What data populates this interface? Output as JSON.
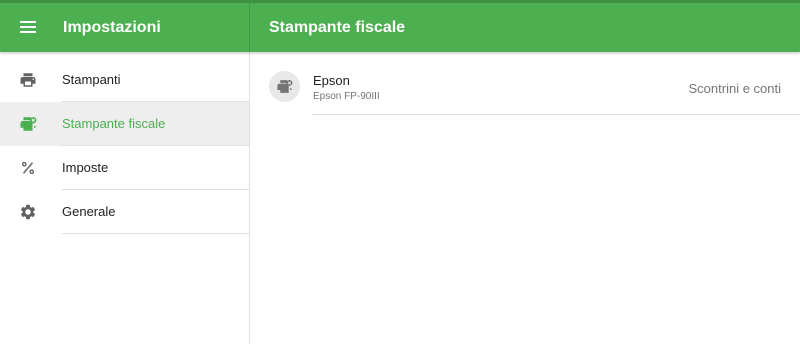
{
  "app": {
    "title": "Impostazioni",
    "menu_icon": "menu-icon",
    "accent_color": "#4caf50"
  },
  "sidebar": {
    "items": [
      {
        "label": "Stampanti",
        "icon": "printer-icon",
        "active": false
      },
      {
        "label": "Stampante fiscale",
        "icon": "fiscal-printer-icon",
        "active": true
      },
      {
        "label": "Imposte",
        "icon": "percent-icon",
        "active": false
      },
      {
        "label": "Generale",
        "icon": "gear-icon",
        "active": false
      }
    ]
  },
  "main": {
    "title": "Stampante fiscale",
    "printers": [
      {
        "name": "Epson",
        "model": "Epson FP-90III",
        "usage": "Scontrini e conti",
        "icon": "fiscal-printer-icon"
      }
    ]
  }
}
